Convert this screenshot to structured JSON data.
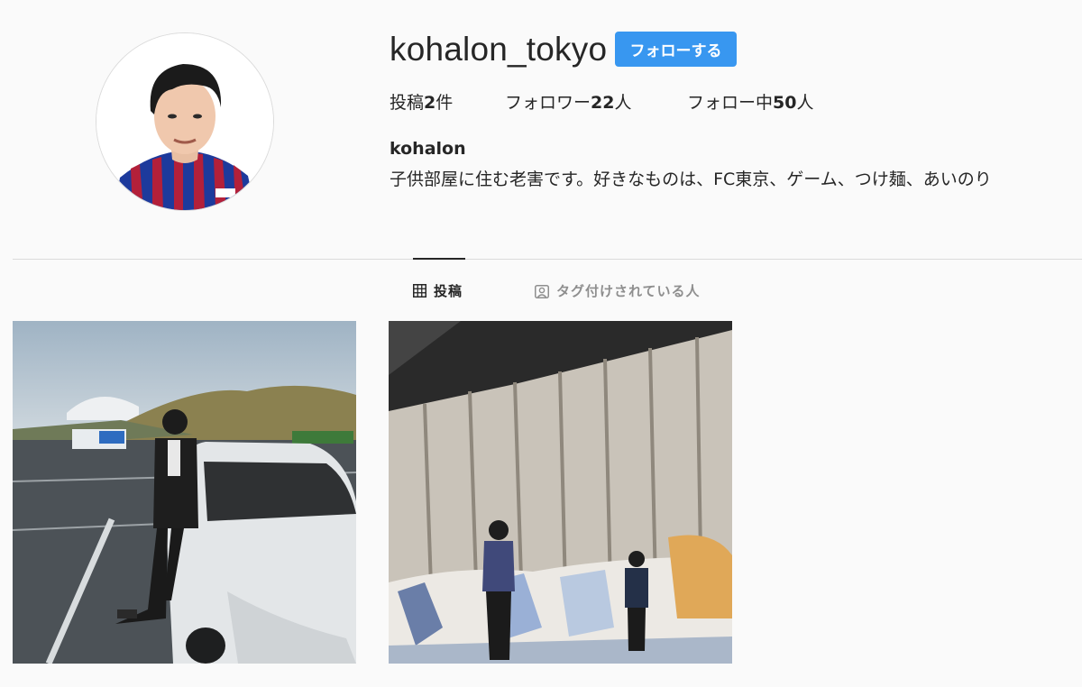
{
  "profile": {
    "username": "kohalon_tokyo",
    "follow_label": "フォローする",
    "display_name": "kohalon",
    "bio": "子供部屋に住む老害です。好きなものは、FC東京、ゲーム、つけ麺、あいのり"
  },
  "stats": {
    "posts": {
      "prefix": "投稿",
      "value": "2",
      "suffix": "件"
    },
    "followers": {
      "prefix": "フォロワー",
      "value": "22",
      "suffix": "人"
    },
    "following": {
      "prefix": "フォロー中",
      "value": "50",
      "suffix": "人"
    }
  },
  "tabs": [
    {
      "label": "投稿",
      "icon": "grid-icon",
      "active": true
    },
    {
      "label": "タグ付けされている人",
      "icon": "tagged-person-icon",
      "active": false
    }
  ],
  "colors": {
    "follow_button": "#3897f0",
    "text": "#262626",
    "muted": "#8e8e8e",
    "background": "#fafafa"
  }
}
